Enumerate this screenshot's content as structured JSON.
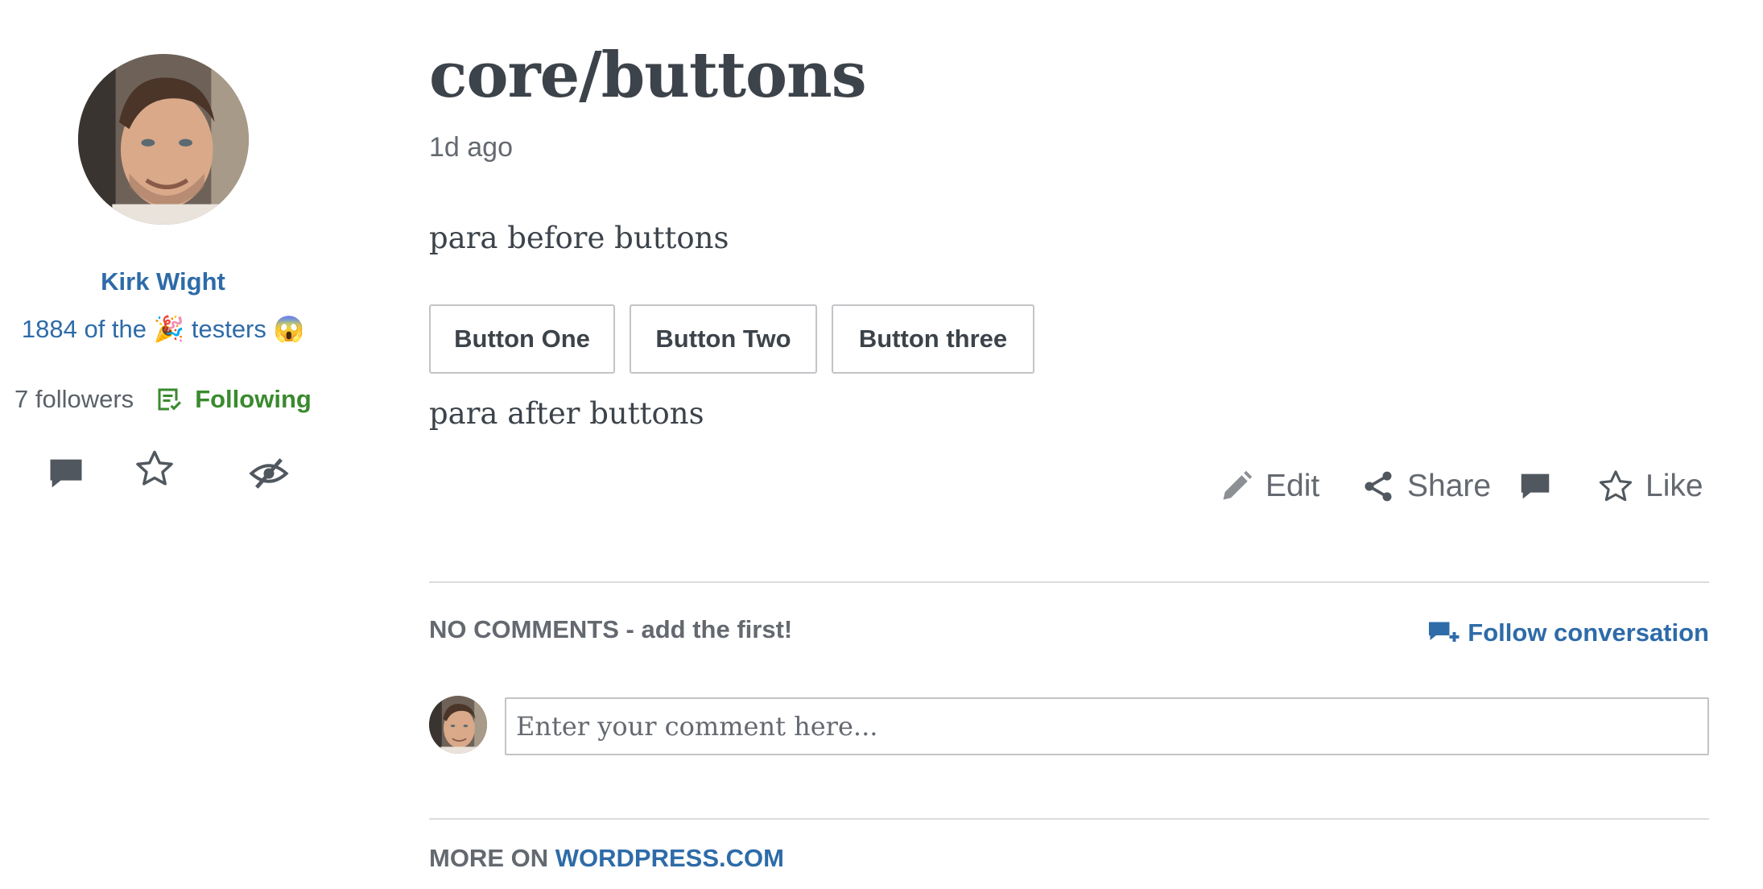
{
  "author": {
    "name": "Kirk Wight",
    "bio": "1884 of the 🎉 testers 😱",
    "followers": "7 followers",
    "following_label": "Following",
    "actions": {
      "comment_icon": "speech-bubble-icon",
      "star_icon": "star-icon",
      "hide_icon": "eye-slash-icon"
    }
  },
  "post": {
    "title": "core/buttons",
    "time": "1d ago",
    "para_before": "para before buttons",
    "buttons": [
      "Button One",
      "Button Two",
      "Button three"
    ],
    "para_after": "para after buttons",
    "actions": {
      "edit": "Edit",
      "share": "Share",
      "like": "Like"
    }
  },
  "comments": {
    "header": "NO COMMENTS - add the first!",
    "follow_conversation": "Follow conversation",
    "input_placeholder": "Enter your comment here..."
  },
  "footer": {
    "more_on": "MORE ON",
    "site": "WORDPRESS.COM"
  },
  "colors": {
    "link": "#2e6ba8",
    "following": "#3a8a2e",
    "text": "#3c434a",
    "muted": "#646970"
  }
}
